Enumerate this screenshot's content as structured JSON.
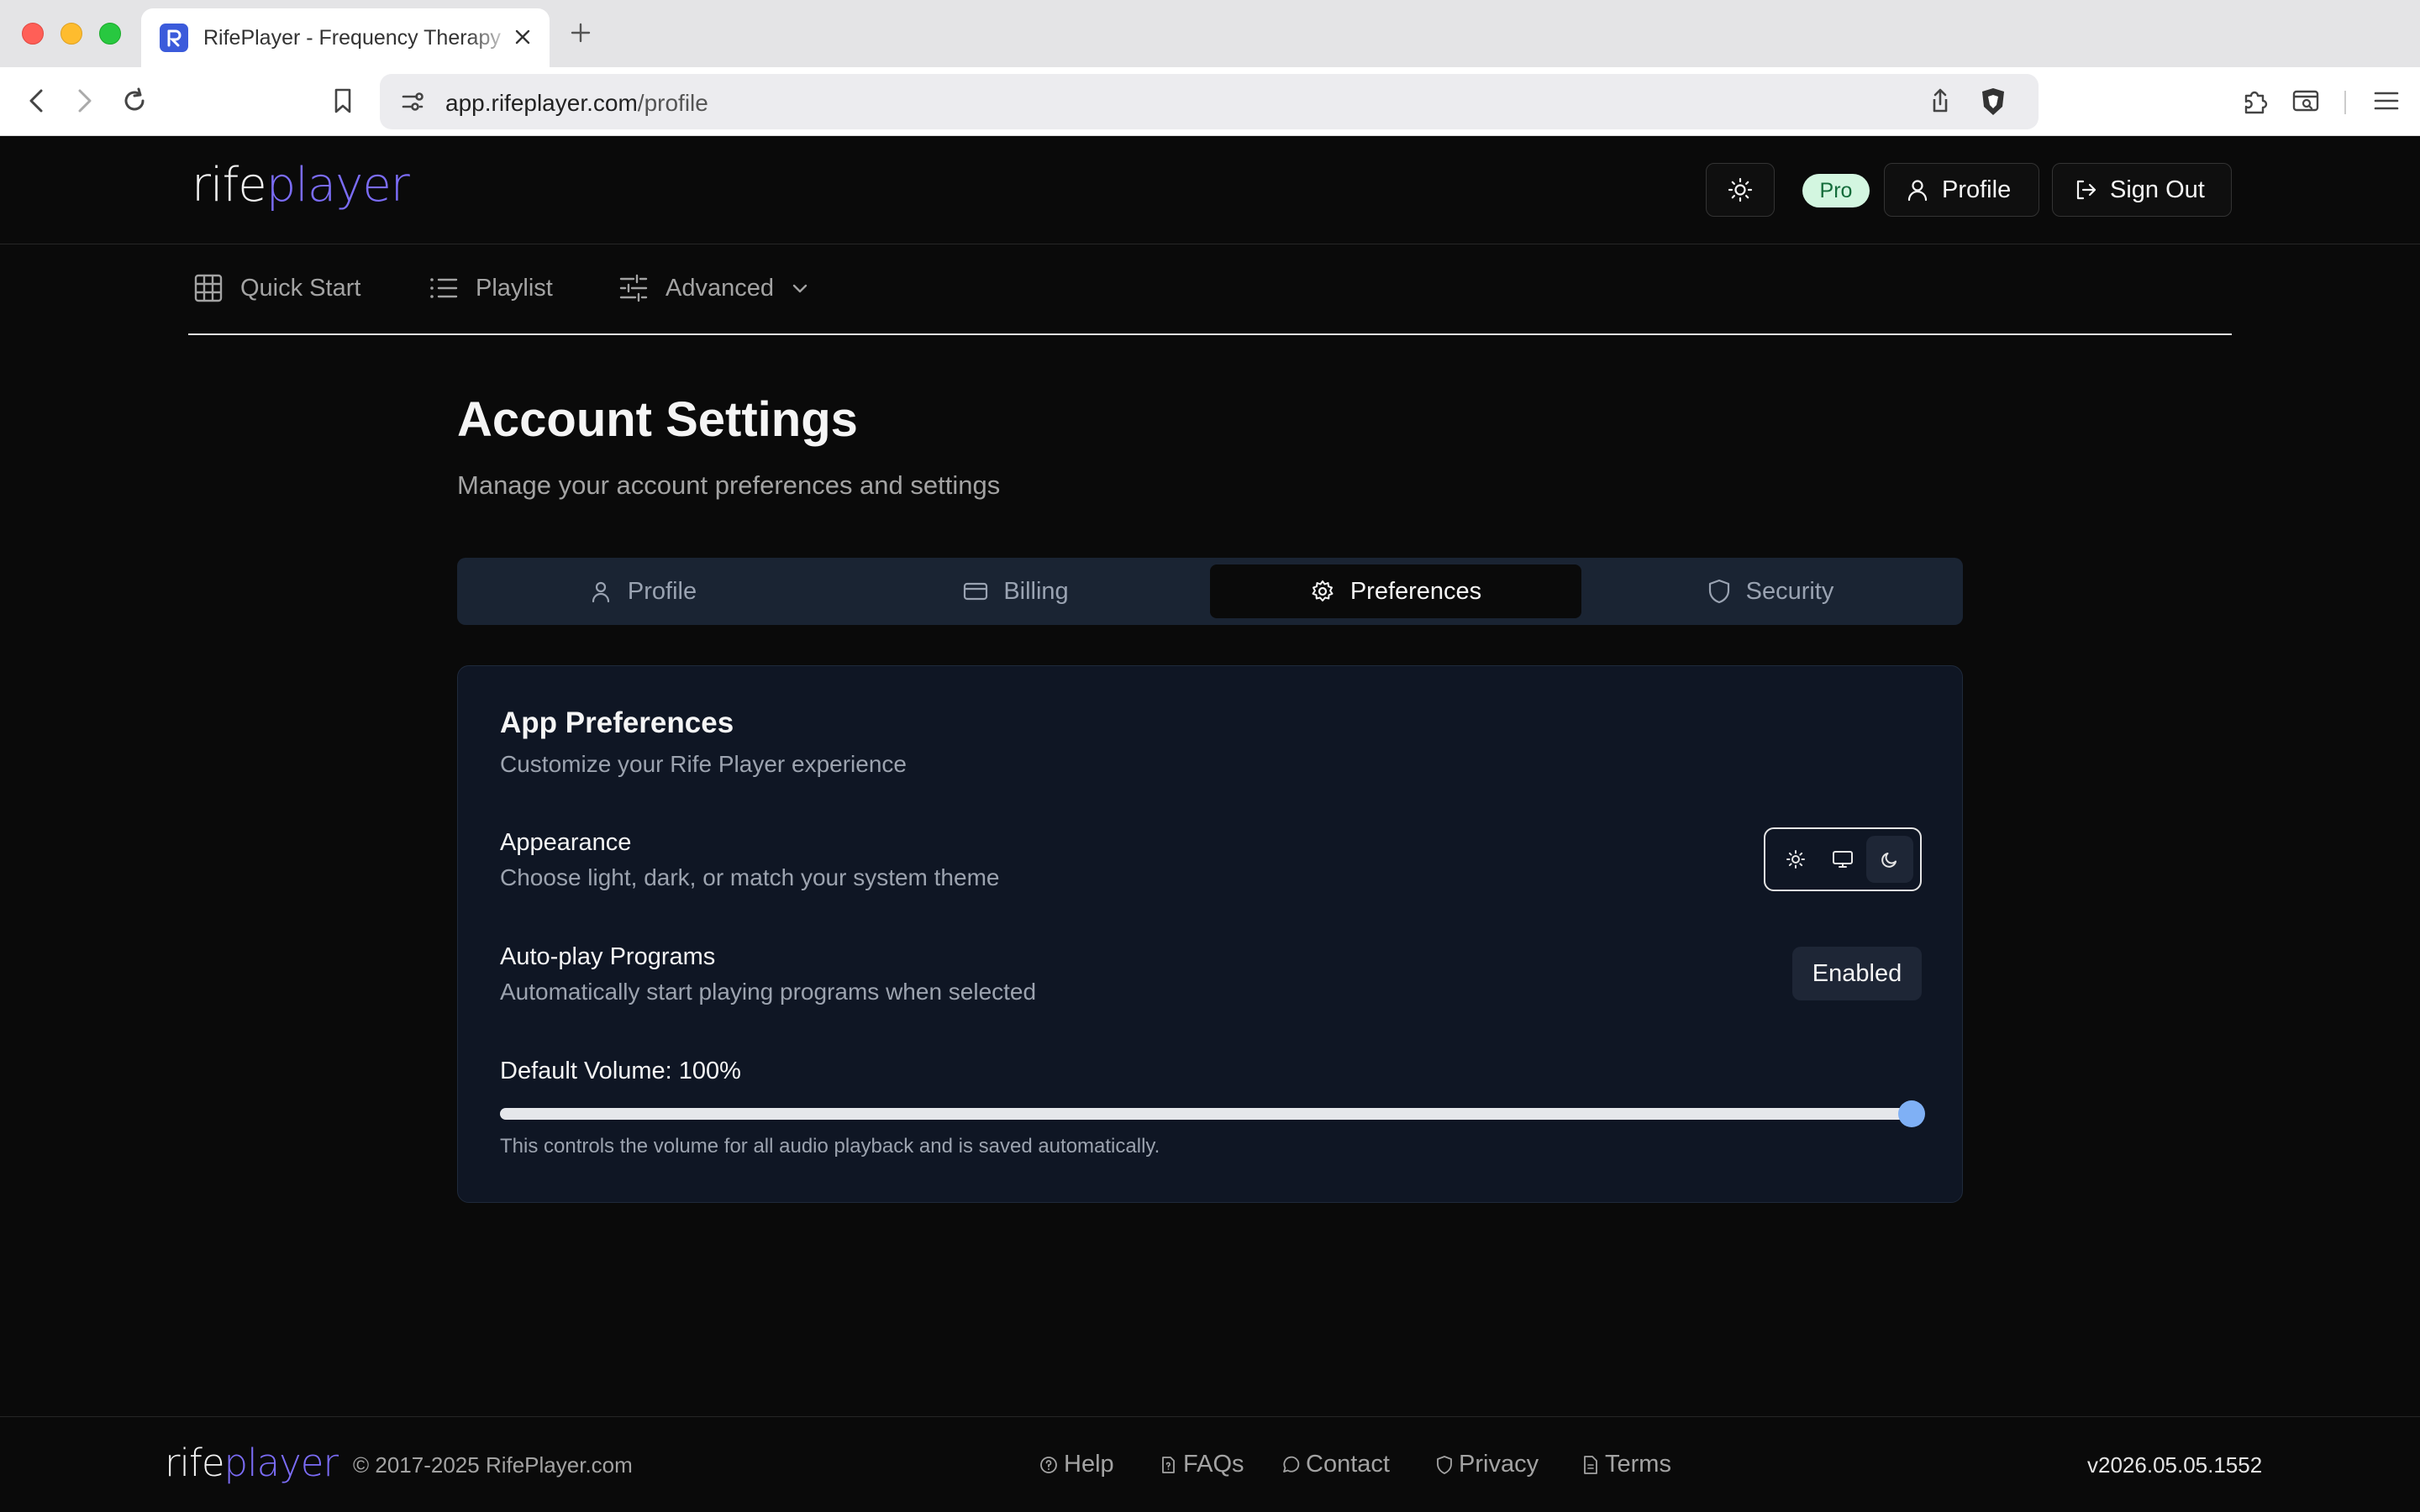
{
  "browser": {
    "tab_title": "RifePlayer - Frequency Therapy",
    "url_host": "app.rifeplayer.com",
    "url_path": "/profile"
  },
  "header": {
    "logo_part1": "rife",
    "logo_part2": "player",
    "badge": "Pro",
    "profile_label": "Profile",
    "signout_label": "Sign Out"
  },
  "nav": {
    "items": [
      {
        "label": "Quick Start",
        "icon": "grid-icon"
      },
      {
        "label": "Playlist",
        "icon": "list-icon"
      },
      {
        "label": "Advanced",
        "icon": "sliders-icon"
      }
    ]
  },
  "page": {
    "title": "Account Settings",
    "subtitle": "Manage your account preferences and settings"
  },
  "settings_tabs": [
    {
      "label": "Profile",
      "icon": "user-icon"
    },
    {
      "label": "Billing",
      "icon": "credit-card-icon"
    },
    {
      "label": "Preferences",
      "icon": "gear-icon",
      "active": true
    },
    {
      "label": "Security",
      "icon": "shield-icon"
    }
  ],
  "preferences": {
    "title": "App Preferences",
    "subtitle": "Customize your Rife Player experience",
    "appearance": {
      "label": "Appearance",
      "description": "Choose light, dark, or match your system theme",
      "options": [
        "sun-icon",
        "monitor-icon",
        "moon-icon"
      ],
      "selected": "moon-icon"
    },
    "autoplay": {
      "label": "Auto-play Programs",
      "description": "Automatically start playing programs when selected",
      "value": "Enabled"
    },
    "volume": {
      "label": "Default Volume: 100%",
      "value_percent": 100,
      "note": "This controls the volume for all audio playback and is saved automatically."
    }
  },
  "footer": {
    "logo_part1": "rife",
    "logo_part2": "player",
    "copyright": "© 2017-2025 RifePlayer.com",
    "links": [
      "Help",
      "FAQs",
      "Contact",
      "Privacy",
      "Terms"
    ],
    "version": "v2026.05.05.1552"
  },
  "colors": {
    "accent": "#7b6cf6",
    "background": "#0a0a0a",
    "card": "#0f1624",
    "slider_thumb": "#7fb0f5",
    "pro_badge": "#d3f6e0"
  }
}
